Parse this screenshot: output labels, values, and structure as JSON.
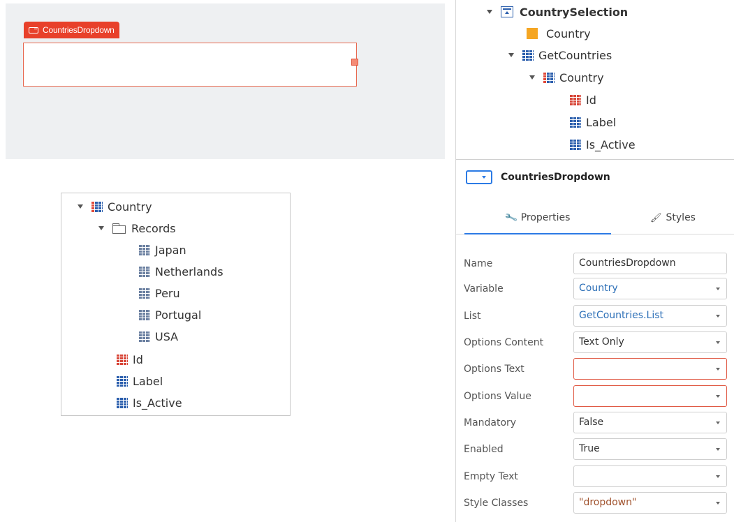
{
  "canvas": {
    "widget_tag": "CountriesDropdown"
  },
  "entity_tree": {
    "root": "Country",
    "folder": "Records",
    "records": [
      "Japan",
      "Netherlands",
      "Peru",
      "Portugal",
      "USA"
    ],
    "attributes": [
      "Id",
      "Label",
      "Is_Active"
    ]
  },
  "widget_tree": {
    "screen": "CountrySelection",
    "variable": "Country",
    "aggregate": "GetCountries",
    "entity": "Country",
    "attributes": [
      "Id",
      "Label",
      "Is_Active"
    ]
  },
  "properties_panel": {
    "widget_name": "CountriesDropdown",
    "tabs": {
      "properties": "Properties",
      "styles": "Styles"
    },
    "rows": [
      {
        "label": "Name",
        "value": "CountriesDropdown"
      },
      {
        "label": "Variable",
        "value": "Country"
      },
      {
        "label": "List",
        "value": "GetCountries.List"
      },
      {
        "label": "Options Content",
        "value": "Text Only"
      },
      {
        "label": "Options Text",
        "value": ""
      },
      {
        "label": "Options Value",
        "value": ""
      },
      {
        "label": "Mandatory",
        "value": "False"
      },
      {
        "label": "Enabled",
        "value": "True"
      },
      {
        "label": "Empty Text",
        "value": ""
      },
      {
        "label": "Style Classes",
        "value": "\"dropdown\""
      }
    ]
  },
  "colors": {
    "accent_red": "#e8402a",
    "accent_blue": "#2c7be5",
    "error_border": "#e05a45",
    "expression_blue": "#2c6fb7",
    "string_brown": "#a0522d"
  }
}
